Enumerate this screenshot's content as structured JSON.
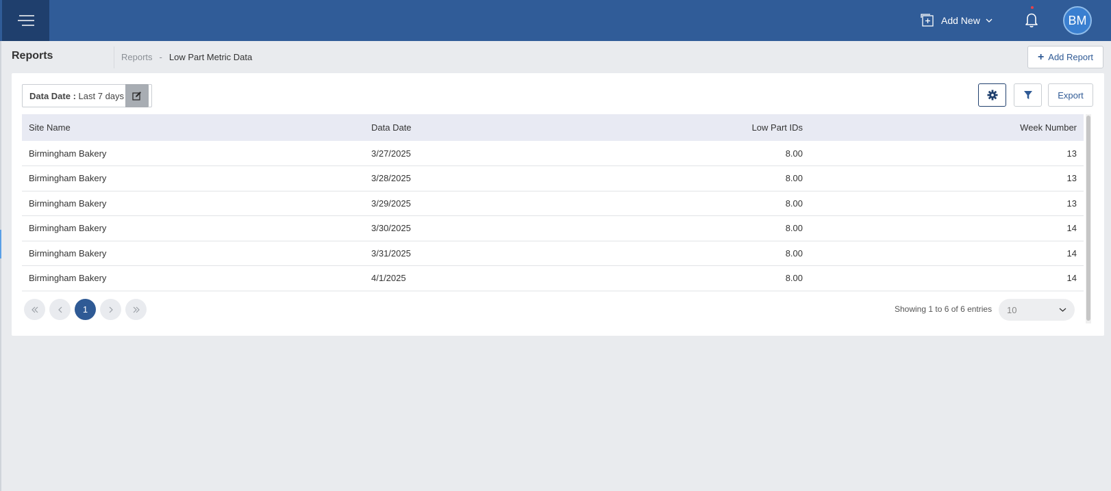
{
  "header": {
    "add_new_label": "Add New",
    "avatar_initials": "BM",
    "colors": {
      "topbar": "#305c98",
      "menu_button": "#1f3f6d",
      "accent": "#2f5a95"
    }
  },
  "page": {
    "title": "Reports",
    "breadcrumb_root": "Reports",
    "breadcrumb_separator": "-",
    "breadcrumb_current": "Low Part Metric Data",
    "add_report_label": "Add Report"
  },
  "toolbar": {
    "date_filter_key": "Data Date :",
    "date_filter_value": "Last 7 days",
    "export_label": "Export"
  },
  "table": {
    "columns": [
      "Site Name",
      "Data Date",
      "Low Part IDs",
      "Week Number"
    ],
    "rows": [
      [
        "Birmingham Bakery",
        "3/27/2025",
        "8.00",
        "13"
      ],
      [
        "Birmingham Bakery",
        "3/28/2025",
        "8.00",
        "13"
      ],
      [
        "Birmingham Bakery",
        "3/29/2025",
        "8.00",
        "13"
      ],
      [
        "Birmingham Bakery",
        "3/30/2025",
        "8.00",
        "14"
      ],
      [
        "Birmingham Bakery",
        "3/31/2025",
        "8.00",
        "14"
      ],
      [
        "Birmingham Bakery",
        "4/1/2025",
        "8.00",
        "14"
      ]
    ]
  },
  "pagination": {
    "current_page": "1",
    "showing_text": "Showing 1 to 6 of 6 entries",
    "page_size": "10"
  }
}
